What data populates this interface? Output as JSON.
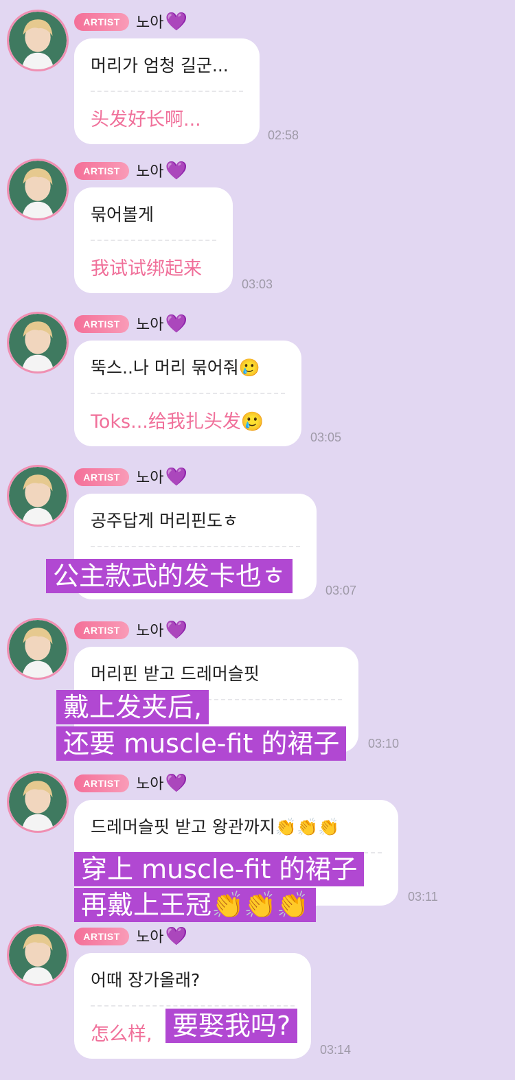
{
  "messages": [
    {
      "badge": "ARTIST",
      "name": "노아",
      "heart": "💜",
      "ko": "머리가 엄청 길군...",
      "zh": "头发好长啊...",
      "time": "02:58"
    },
    {
      "badge": "ARTIST",
      "name": "노아",
      "heart": "💜",
      "ko": "묶어볼게",
      "zh": "我试试绑起来",
      "time": "03:03"
    },
    {
      "badge": "ARTIST",
      "name": "노아",
      "heart": "💜",
      "ko": "뚝스..나 머리 묶어줘🥲",
      "zh": "Toks...给我扎头发🥲",
      "time": "03:05"
    },
    {
      "badge": "ARTIST",
      "name": "노아",
      "heart": "💜",
      "ko": "공주답게 머리핀도ㅎ",
      "zh": "",
      "time": "03:07"
    },
    {
      "badge": "ARTIST",
      "name": "노아",
      "heart": "💜",
      "ko": "머리핀 받고 드레머슬핏",
      "zh": "",
      "time": "03:10"
    },
    {
      "badge": "ARTIST",
      "name": "노아",
      "heart": "💜",
      "ko": "드레머슬핏 받고 왕관까지👏👏👏",
      "zh": "",
      "time": "03:11"
    },
    {
      "badge": "ARTIST",
      "name": "노아",
      "heart": "💜",
      "ko": "어때 장가올래?",
      "zh": "怎么样,",
      "time": "03:14"
    }
  ],
  "overlays": {
    "o4_line1": "公主款式的发卡也ㅎ",
    "o5_line1": "戴上发夹后,",
    "o5_line2": "还要 muscle-fit 的裙子",
    "o6_line1": "穿上 muscle-fit 的裙子",
    "o6_line2": "再戴上王冠👏👏👏",
    "o7_line1": "要娶我吗?"
  },
  "colors": {
    "background": "#e2d7f2",
    "badge": "#f46f98",
    "translation": "#f0709a",
    "overlay": "#b148d2",
    "heart": "#9b39ea"
  },
  "icons": {
    "avatar": "avatar-icon",
    "heart": "purple-heart-icon"
  }
}
